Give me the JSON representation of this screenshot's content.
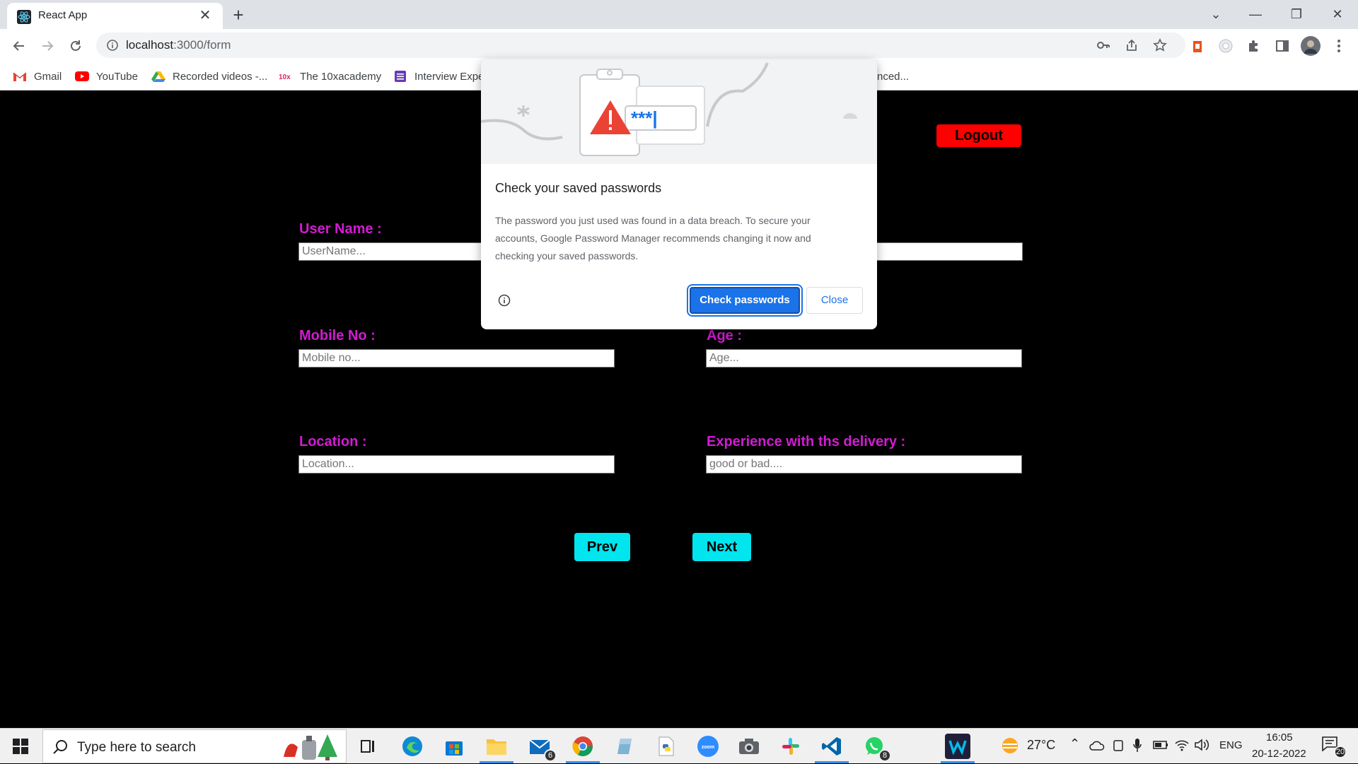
{
  "browser": {
    "tab_title": "React App",
    "tab_close": "✕",
    "new_tab": "+",
    "url_host": "localhost",
    "url_rest": ":3000/form",
    "window_controls": {
      "minimize": "—",
      "restore": "❐",
      "close": "✕",
      "tab_search": "⌄"
    }
  },
  "bookmarks": [
    {
      "label": "Gmail",
      "icon": "gmail-icon"
    },
    {
      "label": "YouTube",
      "icon": "youtube-icon"
    },
    {
      "label": "Recorded videos -...",
      "icon": "google-drive-icon"
    },
    {
      "label": "The 10xacademy",
      "icon": "10x-icon"
    },
    {
      "label": "Interview Expe",
      "icon": "forms-icon"
    },
    {
      "label": "nced...",
      "icon": ""
    }
  ],
  "page": {
    "logout_label": "Logout",
    "fields": {
      "username": {
        "label": "User Name :",
        "placeholder": "UserName..."
      },
      "mobile": {
        "label": "Mobile No :",
        "placeholder": "Mobile no..."
      },
      "age": {
        "label": "Age :",
        "placeholder": "Age..."
      },
      "location": {
        "label": "Location :",
        "placeholder": "Location..."
      },
      "experience": {
        "label": "Experience with ths delivery :",
        "placeholder": "good or bad...."
      }
    },
    "prev_label": "Prev",
    "next_label": "Next",
    "colors": {
      "label": "#d31bd3",
      "nav_button": "#00e5ee",
      "logout": "#ff0000",
      "background": "#000000"
    }
  },
  "dialog": {
    "title": "Check your saved passwords",
    "body": "The password you just used was found in a data breach. To secure your accounts, Google Password Manager recommends changing it now and checking your saved passwords.",
    "masked_password": "***|",
    "check_button": "Check passwords",
    "close_button": "Close",
    "accent": "#1a73e8"
  },
  "taskbar": {
    "search_placeholder": "Type here to search",
    "mail_badge": "6",
    "whatsapp_badge": "8",
    "temperature": "27°C",
    "language": "ENG",
    "time": "16:05",
    "date": "20-12-2022",
    "notifications": "20"
  }
}
